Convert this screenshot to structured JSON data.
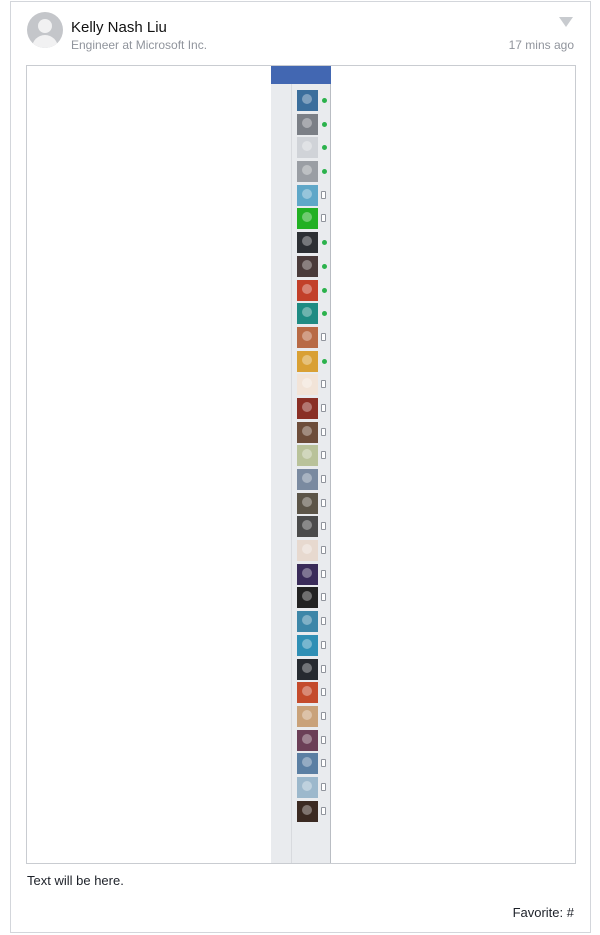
{
  "post": {
    "author_name": "Kelly Nash Liu",
    "author_title": "Engineer at Microsoft Inc.",
    "timestamp": "17 mins ago",
    "text": "Text will be here.",
    "favorite_label": "Favorite:",
    "favorite_value": "#"
  },
  "colors": {
    "online": "#2bb24c",
    "facebook_blue": "#4267b2"
  },
  "chat_contacts": [
    {
      "status": "online",
      "color": "#3b6e9c"
    },
    {
      "status": "online",
      "color": "#7b7f86"
    },
    {
      "status": "online",
      "color": "#d0d3d8"
    },
    {
      "status": "online",
      "color": "#9a9ea4"
    },
    {
      "status": "mobile",
      "color": "#5fa7c8"
    },
    {
      "status": "mobile",
      "color": "#22b024"
    },
    {
      "status": "online",
      "color": "#2c2f33"
    },
    {
      "status": "online",
      "color": "#4a3b3a"
    },
    {
      "status": "online",
      "color": "#c2402a"
    },
    {
      "status": "online",
      "color": "#1f8b83"
    },
    {
      "status": "mobile",
      "color": "#b86a45"
    },
    {
      "status": "online",
      "color": "#d9a034"
    },
    {
      "status": "mobile",
      "color": "#f2e4d8"
    },
    {
      "status": "mobile",
      "color": "#8a2f25"
    },
    {
      "status": "mobile",
      "color": "#6d4d3a"
    },
    {
      "status": "mobile",
      "color": "#b9c29a"
    },
    {
      "status": "mobile",
      "color": "#7a8aa0"
    },
    {
      "status": "mobile",
      "color": "#5c5548"
    },
    {
      "status": "mobile",
      "color": "#4b4b4b"
    },
    {
      "status": "mobile",
      "color": "#e7d9cf"
    },
    {
      "status": "mobile",
      "color": "#3a2c5a"
    },
    {
      "status": "mobile",
      "color": "#222222"
    },
    {
      "status": "mobile",
      "color": "#3d86a8"
    },
    {
      "status": "mobile",
      "color": "#2f8fb5"
    },
    {
      "status": "mobile",
      "color": "#262a30"
    },
    {
      "status": "mobile",
      "color": "#c44b2c"
    },
    {
      "status": "mobile",
      "color": "#c9a27a"
    },
    {
      "status": "mobile",
      "color": "#6b3f57"
    },
    {
      "status": "mobile",
      "color": "#5b7fa3"
    },
    {
      "status": "mobile",
      "color": "#9cb8cc"
    },
    {
      "status": "mobile",
      "color": "#3b2a22"
    }
  ]
}
